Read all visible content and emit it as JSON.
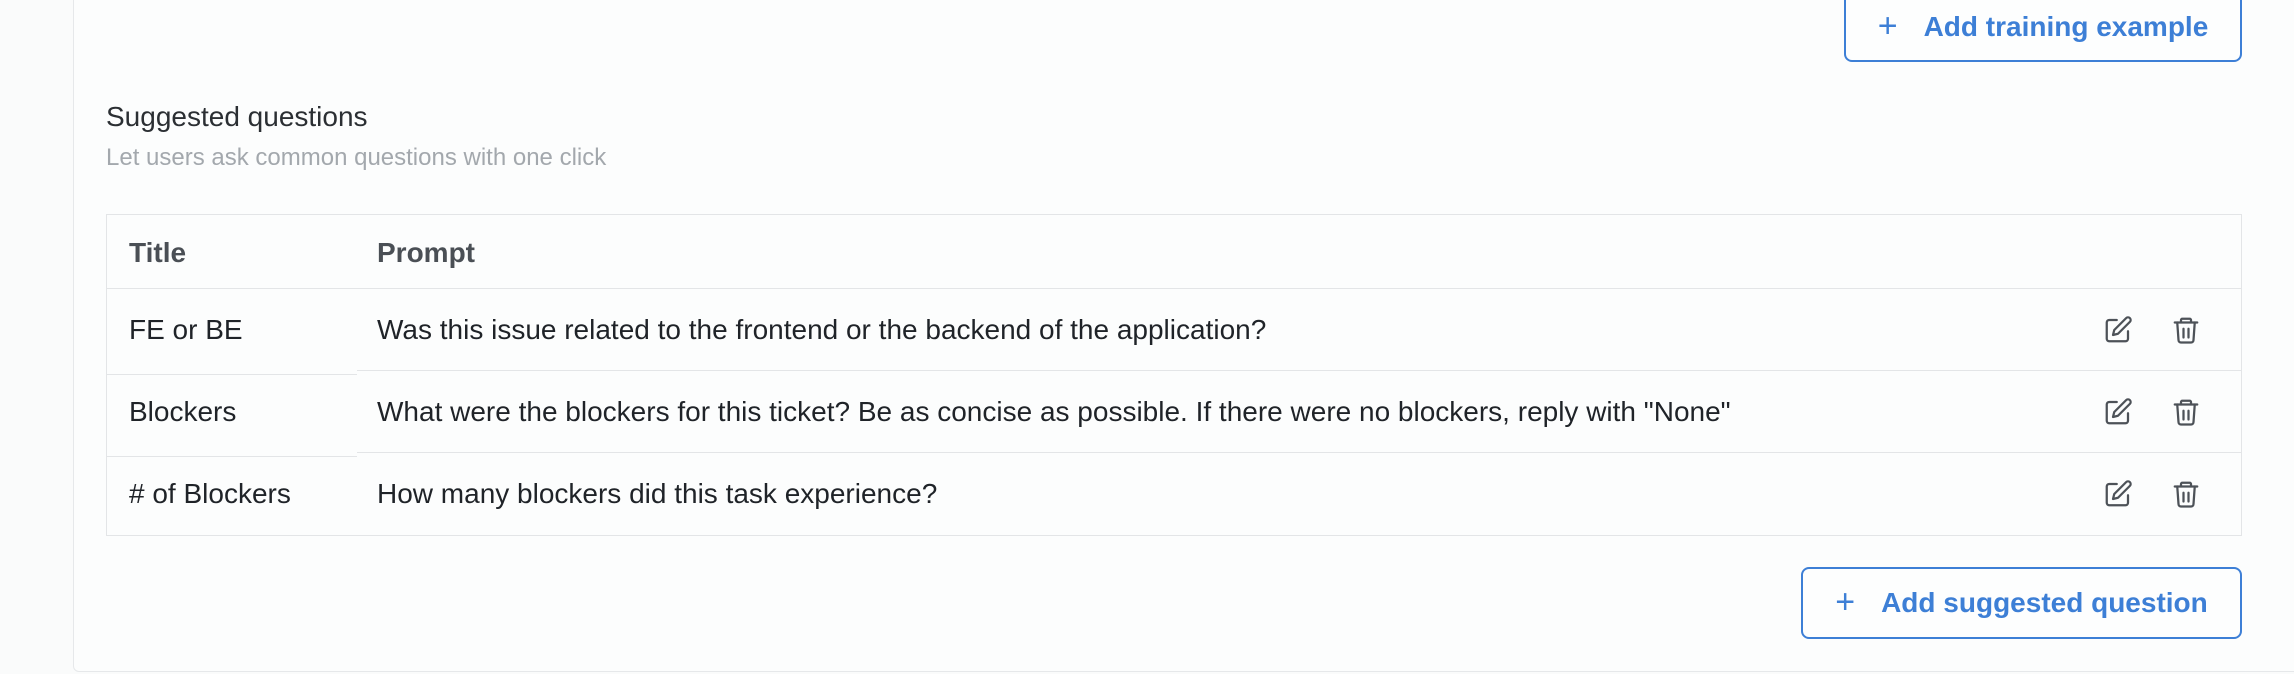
{
  "training": {
    "add_button_label": "Add training example",
    "add_button_icon": "plus-icon"
  },
  "suggested": {
    "title": "Suggested questions",
    "subtitle": "Let users ask common questions with one click",
    "columns": {
      "title": "Title",
      "prompt": "Prompt"
    },
    "rows": [
      {
        "title": "FE or BE",
        "prompt": "Was this issue related to the frontend or the backend of the application?"
      },
      {
        "title": "Blockers",
        "prompt": "What were the blockers for this ticket? Be as concise as possible. If there were no blockers, reply with \"None\""
      },
      {
        "title": "# of Blockers",
        "prompt": "How many blockers did this task experience?"
      }
    ],
    "row_icons": [
      "edit-icon",
      "trash-icon"
    ],
    "add_button_label": "Add suggested question",
    "add_button_icon": "plus-icon"
  },
  "colors": {
    "accent": "#3d7fd6",
    "border": "#e3e5e7",
    "muted_text": "#a3a8ad",
    "icon": "#4d5258"
  }
}
